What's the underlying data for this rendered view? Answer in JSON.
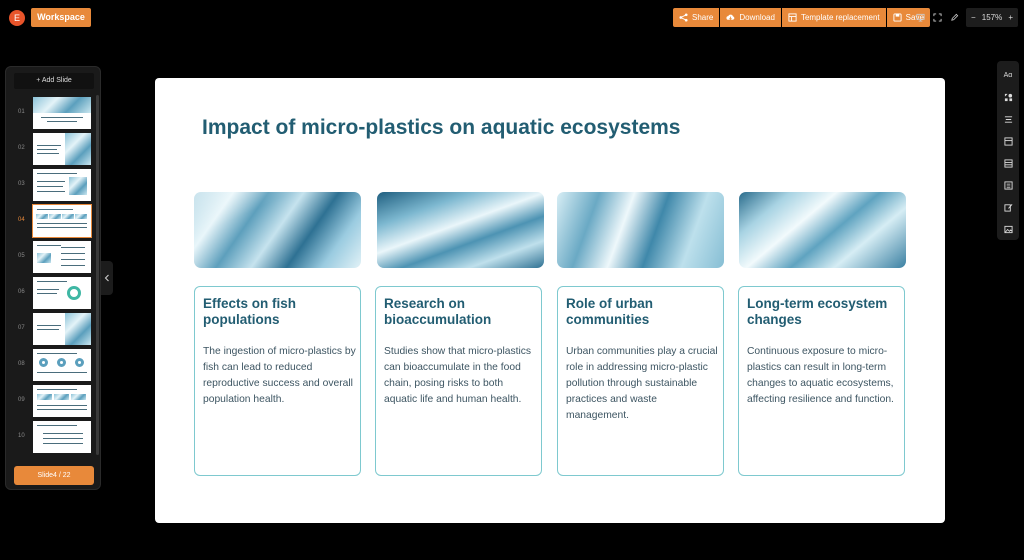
{
  "app": {
    "avatar_letter": "E",
    "workspace_label": "Workspace"
  },
  "toolbar": {
    "share": "Share",
    "download": "Download",
    "template": "Template replacement",
    "save": "Save",
    "zoom_minus": "−",
    "zoom": "157%",
    "zoom_plus": "+"
  },
  "sidebar": {
    "add_slide": "+ Add Slide",
    "slides": [
      "01",
      "02",
      "03",
      "04",
      "05",
      "06",
      "07",
      "08",
      "09",
      "10"
    ],
    "active_index": 3,
    "counter": "Slide4 / 22"
  },
  "right_toolbar": {
    "text_icon": "Aα",
    "icons": [
      "text-style-icon",
      "shapes-icon",
      "align-icon",
      "layout-icon",
      "table-icon",
      "list-icon",
      "edit-icon",
      "image-icon"
    ]
  },
  "slide": {
    "title": "Impact of micro-plastics on aquatic ecosystems",
    "cards": [
      {
        "title": "Effects on fish populations",
        "body": "The ingestion of micro-plastics by fish can lead to reduced reproductive success and overall population health."
      },
      {
        "title": "Research on bioaccumulation",
        "body": "Studies show that micro-plastics can bioaccumulate in the food chain, posing risks to both aquatic life and human health."
      },
      {
        "title": "Role of urban communities",
        "body": "Urban communities play a crucial role in addressing micro-plastic pollution through sustainable practices and waste management."
      },
      {
        "title": "Long-term ecosystem changes",
        "body": "Continuous exposure to micro-plastics can result in long-term changes to aquatic ecosystems, affecting resilience and function."
      }
    ]
  },
  "colors": {
    "accent": "#e8893a",
    "title": "#225d72",
    "card_border": "#7ec9cf"
  }
}
